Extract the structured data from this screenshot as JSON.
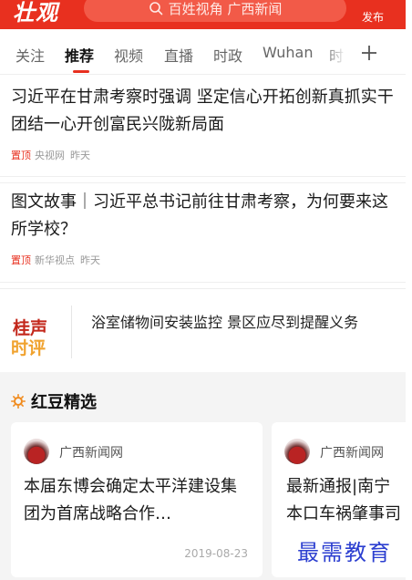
{
  "header": {
    "logo_text": "壮观",
    "search_placeholder": "百姓视角 广西新闻",
    "publish_label": "发布",
    "accent_color": "#e8301f"
  },
  "tabs": [
    {
      "label": "关注",
      "active": false
    },
    {
      "label": "推荐",
      "active": true
    },
    {
      "label": "视频",
      "active": false
    },
    {
      "label": "直播",
      "active": false
    },
    {
      "label": "时政",
      "active": false
    },
    {
      "label": "Wuhan",
      "active": false
    },
    {
      "label": "时",
      "active": false
    }
  ],
  "add_channel_icon": "plus-icon",
  "news": [
    {
      "title": "习近平在甘肃考察时强调 坚定信心开拓创新真抓实干 团结一心开创富民兴陇新局面",
      "pinned_label": "置顶",
      "source": "央视网",
      "time": "昨天"
    },
    {
      "title": "图文故事｜习近平总书记前往甘肃考察，为何要来这所学校？",
      "pinned_label": "置顶",
      "source": "新华视点",
      "time": "昨天"
    }
  ],
  "commentary": {
    "logo_line1": "桂声",
    "logo_line2": "时评",
    "title": "浴室储物间安装监控 景区应尽到提醒义务"
  },
  "picks": {
    "title": "红豆精选",
    "cards": [
      {
        "source": "广西新闻网",
        "title": "本届东博会确定太平洋建设集团为首席战略合作…",
        "date": "2019-08-23"
      },
      {
        "source": "广西新闻网",
        "title": "最新通报|南宁本口车祸肇事司机",
        "date": ""
      }
    ]
  },
  "watermark": "最需教育"
}
